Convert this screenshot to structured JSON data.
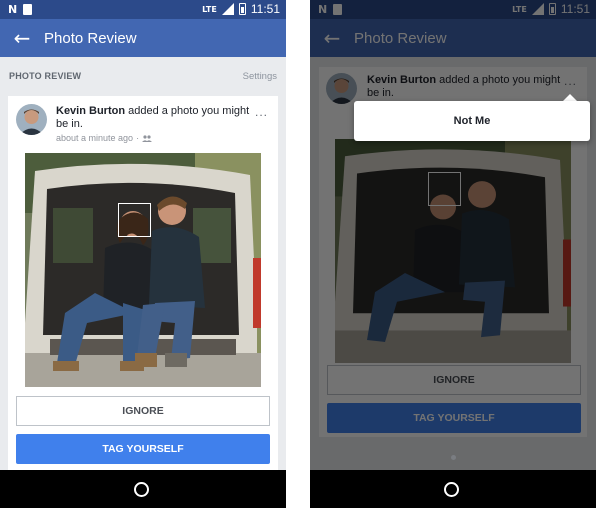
{
  "status_bar": {
    "time": "11:51",
    "network": "LTE",
    "left_glyph": "N"
  },
  "app_bar": {
    "title": "Photo Review",
    "back_icon": "arrow-left"
  },
  "section": {
    "label": "PHOTO REVIEW",
    "settings_link": "Settings"
  },
  "post": {
    "author": "Kevin Burton",
    "action_text": " added a photo you might be in.",
    "timestamp": "about a minute ago",
    "separator": "·",
    "audience_icon": "friends-icon",
    "more_label": "..."
  },
  "actions": {
    "ignore_label": "IGNORE",
    "tag_label": "TAG YOURSELF"
  },
  "menu": {
    "not_me_label": "Not Me"
  },
  "colors": {
    "status_bar": "#2c4a8a",
    "app_bar": "#4267b2",
    "primary_button": "#4080ec",
    "background": "#e9ebee"
  }
}
